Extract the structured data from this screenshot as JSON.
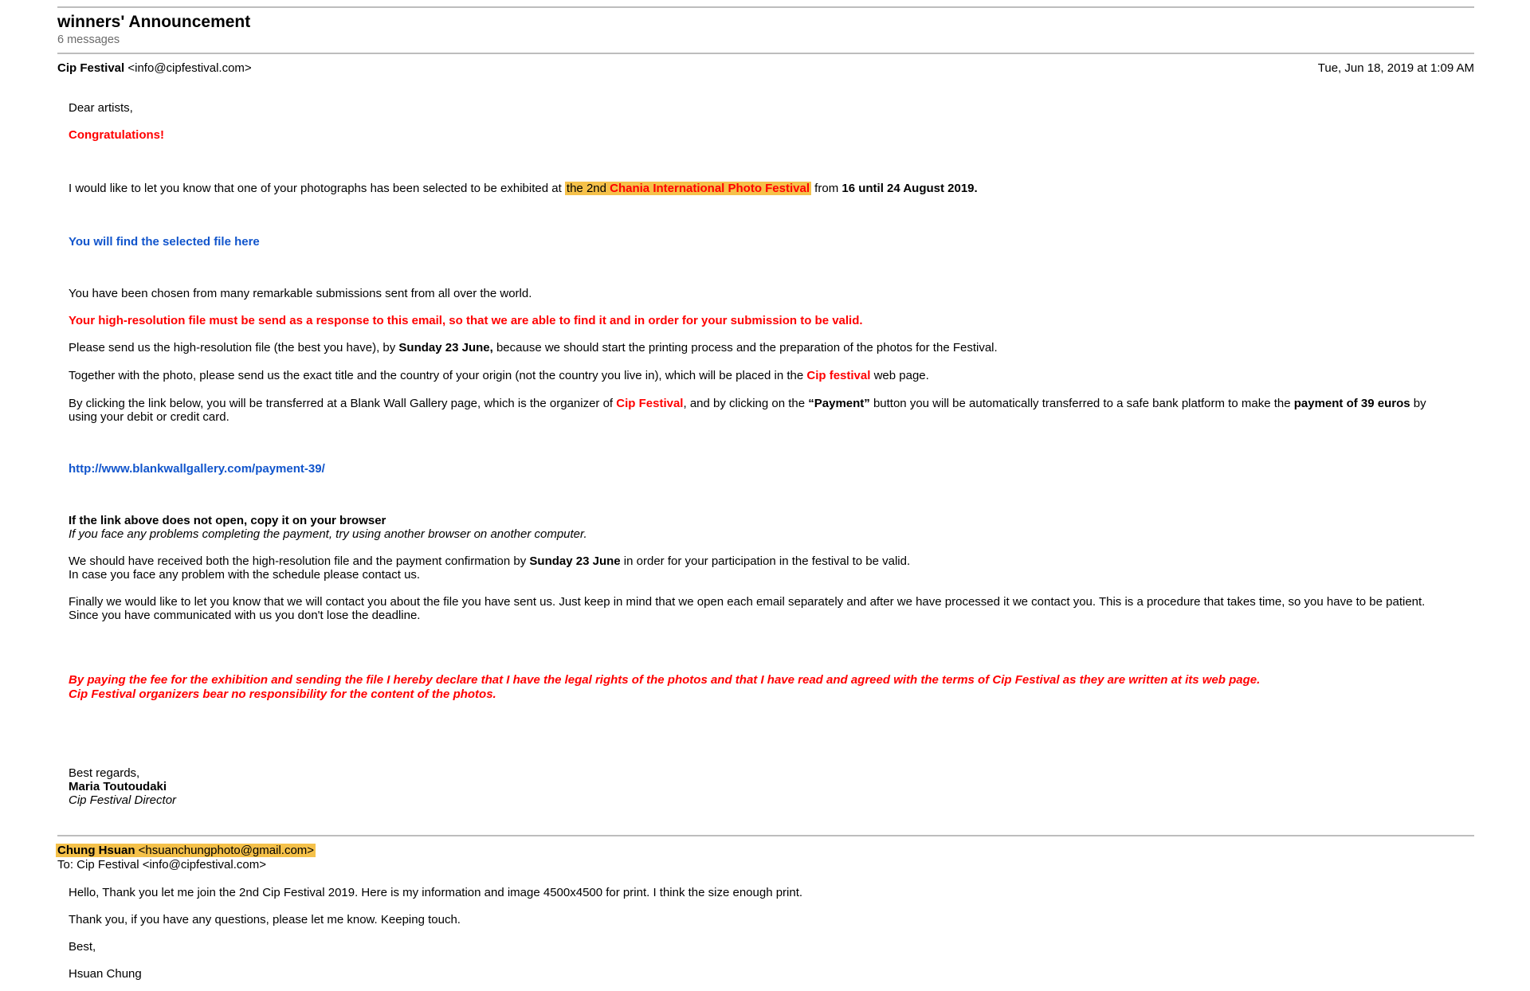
{
  "thread": {
    "subject": "winners' Announcement",
    "count": "6 messages"
  },
  "msg1": {
    "sender_name": "Cip Festival",
    "sender_email": "<info@cipfestival.com>",
    "date": "Tue, Jun 18, 2019 at 1:09 AM",
    "greeting": "Dear artists,",
    "congrats": "Congratulations!",
    "p1_a": "I would like to let you know that one of your photographs has been selected to be exhibited at ",
    "p1_hl_a": "the 2nd ",
    "p1_hl_b": "Chania International Photo Festival",
    "p1_b": " from ",
    "p1_dates": "16 until 24 August 2019.",
    "file_link": "You will find the selected file here",
    "p2": "You have been chosen from many remarkable submissions sent from all over the world.",
    "p3": "Your high-resolution file must be send as a response to this email, so that we are able to find it and in order for your submission to be valid.",
    "p4_a": "Please send us the high-resolution file (the best you have), by ",
    "p4_b": "Sunday 23 June,",
    "p4_c": " because we should start the printing process and the preparation of the photos for the Festival.",
    "p5_a": "Together with the photo, please send us the exact title and the country of your origin (not the country you live in), which will be placed in the ",
    "p5_b": "Cip festival",
    "p5_c": " web page.",
    "p6_a": "By clicking the link below, you will be transferred at a Blank Wall Gallery page, which is the organizer of ",
    "p6_b": "Cip Festival",
    "p6_c": ", and by clicking on the ",
    "p6_d": "“Payment”",
    "p6_e": " button you will be automatically transferred to a safe bank platform to make the ",
    "p6_f": "payment of 39 euros",
    "p6_g": " by",
    "p6_line2": "using your debit or credit card.",
    "payment_link": "http://www.blankwallgallery.com/payment-39/",
    "p7_a": "If the link above does not open, copy it on your browser",
    "p7_b": "If you face any problems completing the payment, try using another browser on another computer.",
    "p8_a": "We should have received both the high-resolution file and the payment confirmation by ",
    "p8_b": "Sunday 23 June",
    "p8_c": " in order for your participation in the festival to be valid.",
    "p8_line2": "In case you face any problem with the schedule please contact us.",
    "p9_line1": "Finally we would like to let you know that we will contact you about the file you have sent us. Just keep in mind that we open each email separately and after we have processed it we contact you. This is a procedure that takes time, so you have to be patient.",
    "p9_line2": "Since you have communicated with us you don't lose the deadline.",
    "p10_line1": "By paying the fee for the exhibition and sending the file I hereby declare that I have the legal rights of the photos and that I have read and agreed with the terms of Cip Festival as they are written at its web page.",
    "p10_line2": "Cip Festival organizers bear no responsibility for the content of the photos.",
    "regards": "Best regards,",
    "sig_name": "Maria Toutoudaki",
    "sig_title": "Cip Festival Director"
  },
  "msg2": {
    "sender_name": "Chung Hsuan",
    "sender_email": "<hsuanchungphoto@gmail.com>",
    "to": "To: Cip Festival <info@cipfestival.com>",
    "p1": "Hello, Thank you let me join the  2nd Cip Festival 2019. Here is my information and image 4500x4500 for print. I think the size enough print.",
    "p2": "Thank you, if you have any questions, please let me know. Keeping touch.",
    "p3": "Best,",
    "p4": "Hsuan Chung"
  },
  "colors": {
    "highlight": "#f5c14a",
    "red": "#ff0000",
    "link": "#1155cc",
    "muted": "#6b6b6b"
  }
}
